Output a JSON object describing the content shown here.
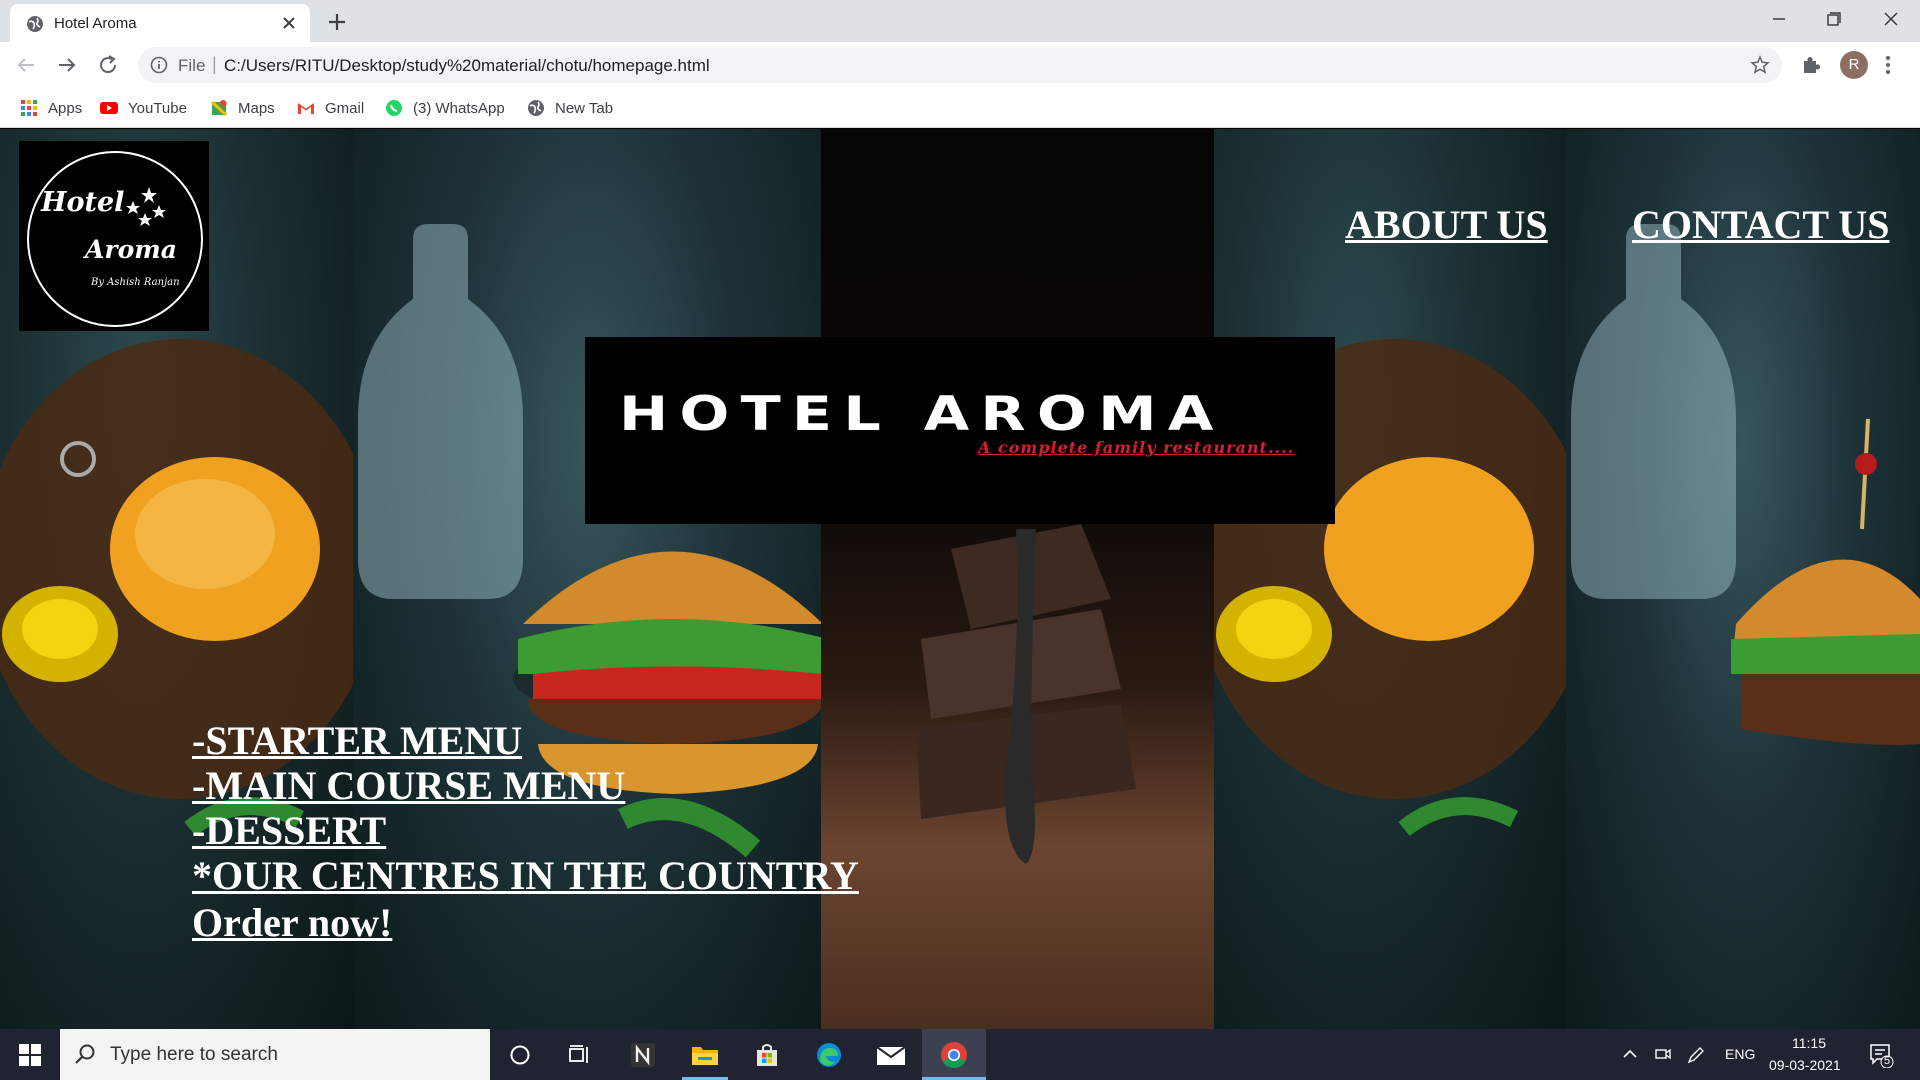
{
  "browser": {
    "tab_title": "Hotel Aroma",
    "url_scheme": "File",
    "url": "C:/Users/RITU/Desktop/study%20material/chotu/homepage.html",
    "profile_initial": "R",
    "bookmarks": [
      {
        "label": "Apps",
        "icon": "apps-grid-icon"
      },
      {
        "label": "YouTube",
        "icon": "youtube-icon"
      },
      {
        "label": "Maps",
        "icon": "maps-icon"
      },
      {
        "label": "Gmail",
        "icon": "gmail-icon"
      },
      {
        "label": "(3) WhatsApp",
        "icon": "whatsapp-icon"
      },
      {
        "label": "New Tab",
        "icon": "globe-icon"
      }
    ]
  },
  "site": {
    "logo": {
      "line1": "Hotel",
      "line2": "Aroma",
      "line3": "By Ashish Ranjan"
    },
    "nav": {
      "about": "ABOUT US",
      "contact": "CONTACT US"
    },
    "banner": {
      "title": "HOTEL AROMA",
      "subtitle": "A complete family restaurant...."
    },
    "menu": [
      "-STARTER MENU",
      "-MAIN COURSE MENU",
      "-DESSERT",
      "*OUR CENTRES IN THE COUNTRY",
      "Order now!"
    ]
  },
  "taskbar": {
    "search_placeholder": "Type here to search",
    "language": "ENG",
    "time": "11:15",
    "date": "09-03-2021",
    "notification_count": "5"
  },
  "colors": {
    "accent_red": "#d4202a",
    "taskbar": "#1f2430",
    "chrome_tabstrip": "#dee1e6"
  }
}
